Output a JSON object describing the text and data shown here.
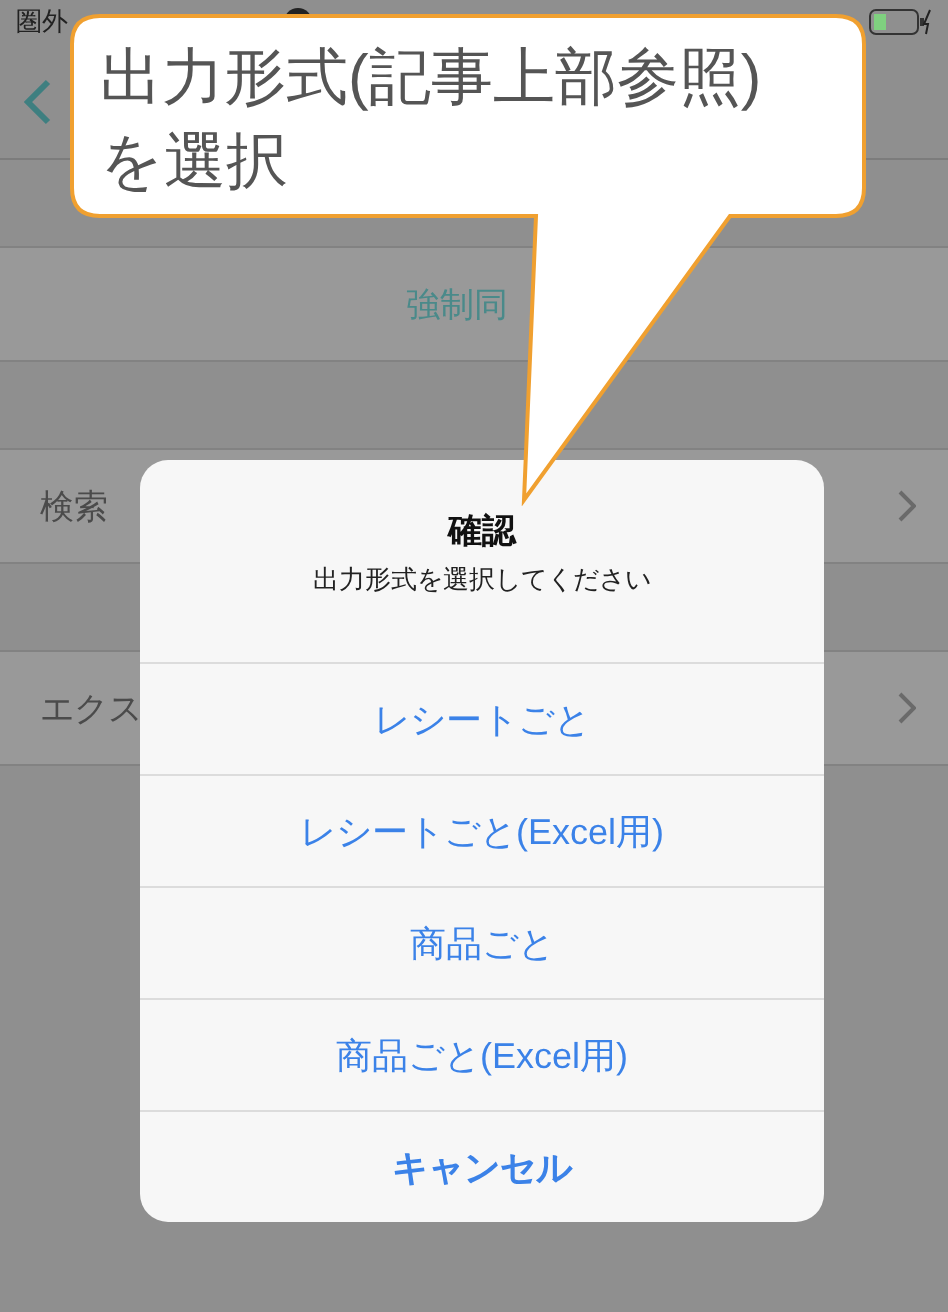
{
  "status_bar": {
    "carrier": "圏外"
  },
  "callout": {
    "lines": [
      "出力形式(記事上部参照)",
      "を選択"
    ]
  },
  "cells": [
    {
      "label": "強制同",
      "kind": "action"
    },
    {
      "label": "検索",
      "kind": "disclosure"
    },
    {
      "label": "エクス",
      "kind": "disclosure"
    }
  ],
  "dialog": {
    "title": "確認",
    "message": "出力形式を選択してください",
    "actions": [
      {
        "label": "レシートごと",
        "kind": "default"
      },
      {
        "label": "レシートごと(Excel用)",
        "kind": "default"
      },
      {
        "label": "商品ごと",
        "kind": "default"
      },
      {
        "label": "商品ごと(Excel用)",
        "kind": "default"
      },
      {
        "label": "キャンセル",
        "kind": "cancel"
      }
    ]
  }
}
